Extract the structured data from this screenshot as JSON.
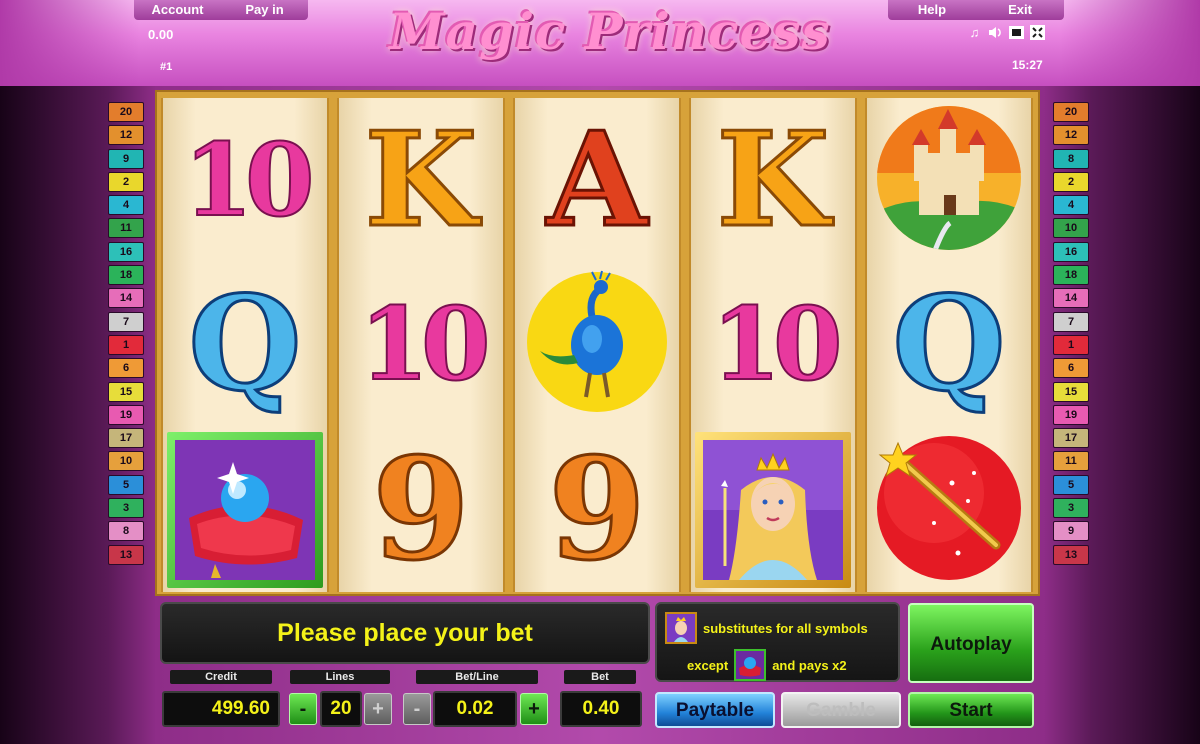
{
  "header": {
    "account_label": "Account",
    "payin_label": "Pay in",
    "help_label": "Help",
    "exit_label": "Exit",
    "account_value": "0.00",
    "game_number": "#1",
    "clock": "15:27",
    "logo_text": "Magic Princess",
    "icons": [
      "music-icon",
      "sound-icon",
      "window-icon",
      "fullscreen-icon"
    ]
  },
  "paylines": {
    "left": [
      "20",
      "12",
      "9",
      "2",
      "4",
      "11",
      "16",
      "18",
      "14",
      "7",
      "1",
      "6",
      "15",
      "19",
      "17",
      "10",
      "5",
      "3",
      "8",
      "13"
    ],
    "right": [
      "20",
      "12",
      "8",
      "2",
      "4",
      "10",
      "16",
      "18",
      "14",
      "7",
      "1",
      "6",
      "15",
      "19",
      "17",
      "11",
      "5",
      "3",
      "9",
      "13"
    ],
    "colors": [
      "#e37d2c",
      "#e3902d",
      "#21b5b3",
      "#e9d72c",
      "#2ab7d2",
      "#33a34b",
      "#2dc0b8",
      "#2bb35a",
      "#e66db9",
      "#cfcfcf",
      "#e22a3a",
      "#ef9a36",
      "#e7dd3a",
      "#e85ab1",
      "#c5b57a",
      "#e6a03c",
      "#2b8fd9",
      "#2fb15d",
      "#e48fc6",
      "#c83649"
    ]
  },
  "reels": [
    [
      "10",
      "Q",
      "crystal-ball"
    ],
    [
      "K",
      "10",
      "9"
    ],
    [
      "A",
      "peacock",
      "9"
    ],
    [
      "K",
      "10",
      "princess"
    ],
    [
      "castle",
      "Q",
      "magic-wand"
    ]
  ],
  "message": "Please place your bet",
  "info": {
    "line1": "substitutes for all symbols",
    "line2_a": "except",
    "line2_b": "and pays x2"
  },
  "fields": {
    "credit_label": "Credit",
    "credit_value": "499.60",
    "lines_label": "Lines",
    "lines_value": "20",
    "betline_label": "Bet/Line",
    "betline_value": "0.02",
    "bet_label": "Bet",
    "bet_value": "0.40",
    "minus": "-",
    "plus": "+"
  },
  "buttons": {
    "autoplay": "Autoplay",
    "paytable": "Paytable",
    "gamble": "Gamble",
    "start": "Start"
  }
}
